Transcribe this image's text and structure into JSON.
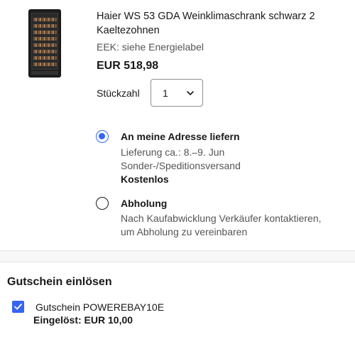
{
  "item": {
    "image_icon": "wine-fridge-image",
    "title": "Haier WS 53 GDA Weinklimaschrank schwarz 2 Kaeltezohnen",
    "eek": "EEK: siehe Energielabel",
    "price": "EUR 518,98",
    "quantity_label": "Stückzahl",
    "quantity_value": "1"
  },
  "delivery": {
    "home": {
      "title": "An meine Adresse liefern",
      "eta": "Lieferung ca.: 8.–9. Jun",
      "method": "Sonder-/Speditionsversand",
      "cost": "Kostenlos",
      "selected": true
    },
    "pickup": {
      "title": "Abholung",
      "line1": "Nach Kaufabwicklung Verkäufer kontaktieren,",
      "line2": "um Abholung zu vereinbaren",
      "selected": false
    }
  },
  "coupon": {
    "heading": "Gutschein einlösen",
    "name": "Gutschein POWEREBAY10E",
    "applied": "Eingelöst: EUR 10,00",
    "checked": true
  },
  "colors": {
    "accent": "#3665f3",
    "text": "#191919",
    "secondary_text": "#555555",
    "separator": "#f7f7f7"
  }
}
